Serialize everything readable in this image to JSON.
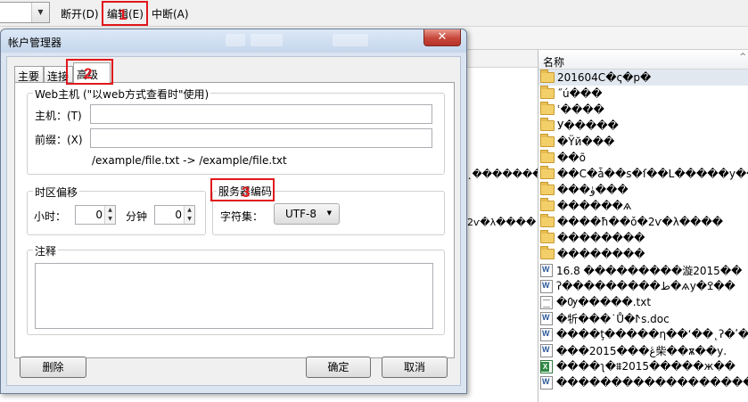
{
  "toolbar": {
    "disconnect": "断开(D)",
    "edit": "编辑(E)",
    "abort": "中断(A)"
  },
  "markers": [
    "1",
    "2",
    "3"
  ],
  "middle_pane": {
    "lines": [
      "˛�������у",
      "2ѵ�λ����"
    ]
  },
  "files": {
    "column_name": "名称",
    "rows": [
      {
        "type": "folder",
        "name": "201604C�ҁ�p�"
      },
      {
        "type": "folder",
        "name": "˝ú���"
      },
      {
        "type": "folder",
        "name": "ʿ����"
      },
      {
        "type": "folder",
        "name": "У�����"
      },
      {
        "type": "folder",
        "name": "�Ÿй���"
      },
      {
        "type": "folder",
        "name": "��õ"
      },
      {
        "type": "folder",
        "name": "��C�ǡ��s�ſ��L�����у���"
      },
      {
        "type": "folder",
        "name": "���ۈ���"
      },
      {
        "type": "folder",
        "name": "������ѧ"
      },
      {
        "type": "folder",
        "name": "����ħ��ǒ�2ѵ�λ����"
      },
      {
        "type": "folder",
        "name": "��������"
      },
      {
        "type": "folder",
        "name": "��������"
      },
      {
        "type": "word",
        "name": "16.8 ���������漩2015��"
      },
      {
        "type": "word",
        "name": "ʔ���������ط�ѧу�ߐ��"
      },
      {
        "type": "text",
        "name": "�Ѹ�����.txt"
      },
      {
        "type": "word",
        "name": "�㸫���˙Ů�ⵤs.doc"
      },
      {
        "type": "word",
        "name": "����ţ�����ƞ��ʻ��˛ʔ�ʹ��"
      },
      {
        "type": "word",
        "name": "���2015���ڠ柴��ѫ��у."
      },
      {
        "type": "excel",
        "name": "����ʅ�⩩2015�����ж��"
      },
      {
        "type": "word",
        "name": "������������������"
      }
    ]
  },
  "dialog": {
    "title": "帐户管理器",
    "close": "✕",
    "tabs": [
      "主要",
      "连接",
      "高级"
    ],
    "web_host": {
      "group": "Web主机 (\"以web方式查看时\"使用)",
      "host_label": "主机：(T)",
      "host_value": "",
      "prefix_label": "前缀：(X)",
      "prefix_value": "",
      "example": "/example/file.txt -> /example/file.txt"
    },
    "timezone": {
      "group": "时区偏移",
      "hours_label": "小时：",
      "hours_value": "0",
      "minutes_label": "分钟",
      "minutes_value": "0"
    },
    "encoding": {
      "group": "服务器编码",
      "charset_label": "字符集：",
      "charset_value": "UTF-8"
    },
    "notes": {
      "group": "注释",
      "value": ""
    },
    "buttons": {
      "delete": "删除",
      "ok": "确定",
      "cancel": "取消"
    }
  }
}
